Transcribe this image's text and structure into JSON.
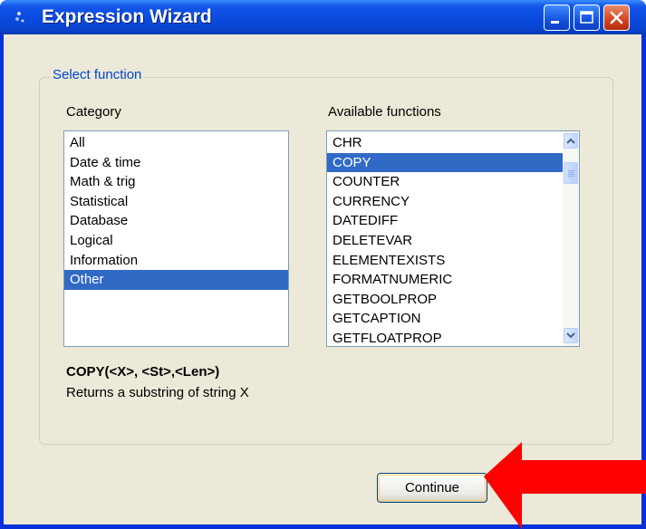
{
  "window": {
    "title": "Expression Wizard"
  },
  "group": {
    "legend": "Select function"
  },
  "category": {
    "label": "Category",
    "items": [
      "All",
      "Date & time",
      "Math & trig",
      "Statistical",
      "Database",
      "Logical",
      "Information",
      "Other"
    ],
    "selected": "Other"
  },
  "functions": {
    "label": "Available functions",
    "items": [
      "CHR",
      "COPY",
      "COUNTER",
      "CURRENCY",
      "DATEDIFF",
      "DELETEVAR",
      "ELEMENTEXISTS",
      "FORMATNUMERIC",
      "GETBOOLPROP",
      "GETCAPTION",
      "GETFLOATPROP"
    ],
    "selected": "COPY"
  },
  "detail": {
    "signature": "COPY(<X>, <St>,<Len>)",
    "description": "Returns a substring of string X"
  },
  "actions": {
    "continue_label": "Continue"
  },
  "colors": {
    "selection": "#316ac5",
    "annotation_arrow": "#ff0000",
    "legend": "#0046d5"
  }
}
